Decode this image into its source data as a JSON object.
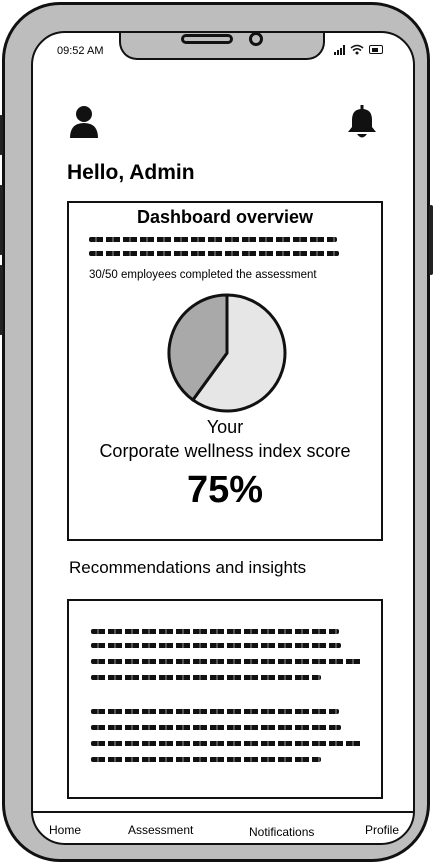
{
  "status_bar": {
    "time": "09:52 AM"
  },
  "header": {
    "user_icon": "user-icon",
    "bell_icon": "bell-icon"
  },
  "greeting": "Hello, Admin",
  "dashboard": {
    "title": "Dashboard overview",
    "completed_text": "30/50 employees completed the assessment",
    "pie": {
      "completed": 30,
      "total": 50,
      "colors": [
        "#e6e6e6",
        "#a9a9a9"
      ]
    },
    "your_label": "Your",
    "index_label": "Corporate wellness index score",
    "score": "75%"
  },
  "recommendations": {
    "heading": "Recommendations and insights"
  },
  "bottom_nav": {
    "home": "Home",
    "assessment": "Assessment",
    "notifications": "Notifications",
    "profile": "Profile"
  }
}
